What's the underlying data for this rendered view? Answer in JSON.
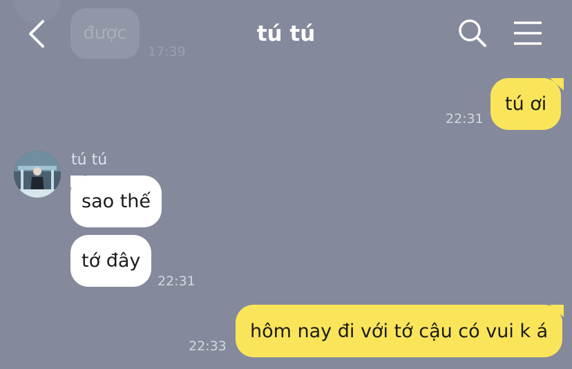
{
  "header": {
    "title": "tú tú",
    "back_icon": "chevron-left-icon",
    "search_icon": "search-icon",
    "menu_icon": "hamburger-menu-icon"
  },
  "previous": {
    "text": "được",
    "time": "17:39"
  },
  "messages": [
    {
      "from": "me",
      "text": "tú ơi",
      "time": "22:31"
    },
    {
      "from": "them",
      "sender": "tú tú",
      "texts": [
        "sao thế",
        "tớ đây"
      ],
      "time": "22:31"
    },
    {
      "from": "me",
      "text": "hôm nay đi với tớ cậu có vui k á",
      "time": "22:33"
    }
  ],
  "colors": {
    "background": "#848a9b",
    "my_bubble": "#fae55a",
    "their_bubble": "#ffffff"
  }
}
